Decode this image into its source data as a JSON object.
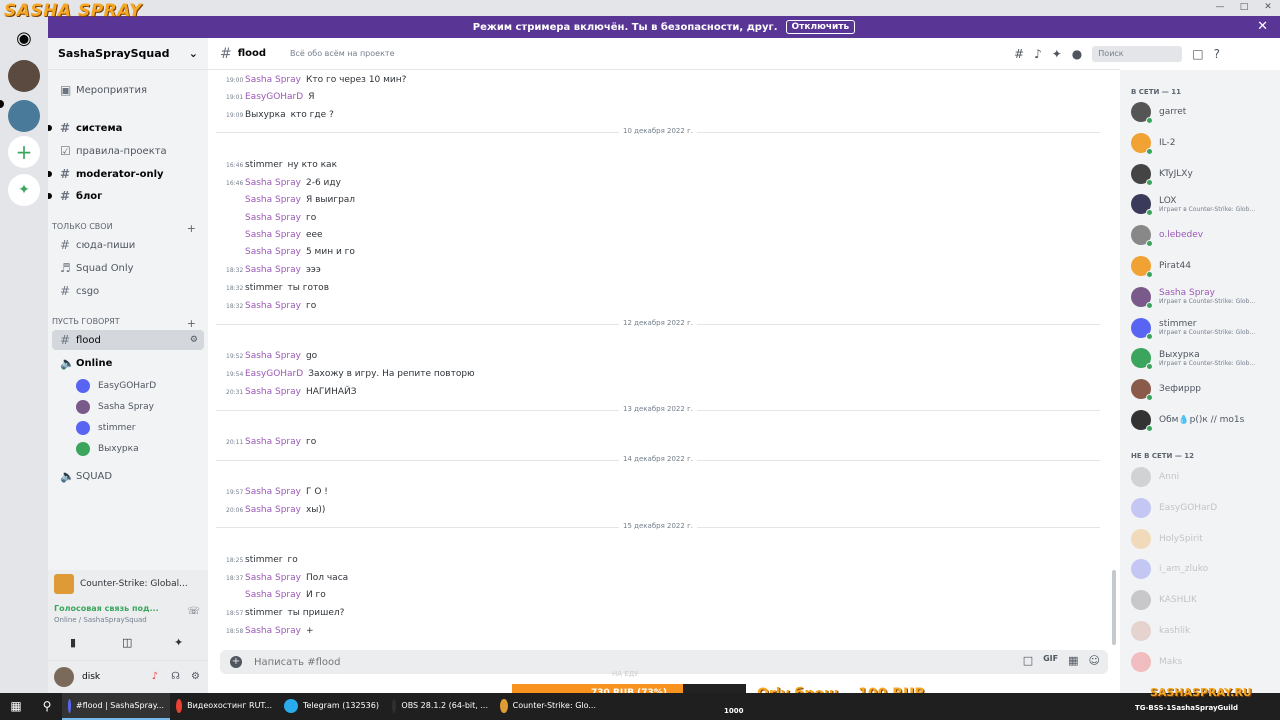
{
  "overlay": {
    "watermark": "SASHA SPRAY",
    "promo": "Orly бронь - 100 RUB",
    "brand": "SASHASPRAY.RU",
    "brand2": "TG-BSS-1SashaSprayGuild"
  },
  "banner": {
    "text": "Режим стримера включён. Ты в безопасности, друг.",
    "button": "Отключить"
  },
  "guild": {
    "name": "SashaSpraySquad"
  },
  "sidebar": {
    "events": "Мероприятия",
    "channels_top": [
      "система",
      "правила-проекта",
      "moderator-only",
      "блог"
    ],
    "cat1": "только свои",
    "channels_cat1": [
      "сюда-пиши",
      "Squad Only",
      "csgo"
    ],
    "cat2": "пусть говорят",
    "active_channel": "flood",
    "voice_channel": "Online",
    "voice_users": [
      "EasyGOHarD",
      "Sasha Spray",
      "stimmer",
      "Выхурка"
    ],
    "squad_channel": "SQUAD",
    "activity": {
      "game": "Counter-Strike: Global...",
      "voice_status": "Голосовая связь под...",
      "voice_sub": "Online / SashaSpraySquad"
    },
    "user": {
      "name": "disk"
    }
  },
  "chat": {
    "channel": "flood",
    "topic": "Всё обо всём на проекте",
    "search_placeholder": "Поиск",
    "composer_placeholder": "Написать #flood",
    "messages": [
      {
        "ts": "19:00",
        "author": "Sasha Spray",
        "color": "purple",
        "text": "Кто го через 10 мин?"
      },
      {
        "ts": "19:01",
        "author": "EasyGOHarD",
        "color": "purple",
        "text": "Я"
      },
      {
        "ts": "19:09",
        "author": "Выхурка",
        "color": "dark",
        "text": "кто где ?"
      },
      {
        "ts": "16:46",
        "author": "stimmer",
        "color": "dark",
        "text": "ну кто как"
      },
      {
        "ts": "16:46",
        "author": "Sasha Spray",
        "color": "purple",
        "text": "2-6 иду"
      },
      {
        "ts": "",
        "author": "Sasha Spray",
        "color": "purple",
        "text": "Я выиграл"
      },
      {
        "ts": "",
        "author": "Sasha Spray",
        "color": "purple",
        "text": "го"
      },
      {
        "ts": "",
        "author": "Sasha Spray",
        "color": "purple",
        "text": "еее"
      },
      {
        "ts": "",
        "author": "Sasha Spray",
        "color": "purple",
        "text": "5 мин и го"
      },
      {
        "ts": "18:32",
        "author": "Sasha Spray",
        "color": "purple",
        "text": "эээ"
      },
      {
        "ts": "18:32",
        "author": "stimmer",
        "color": "dark",
        "text": "ты готов"
      },
      {
        "ts": "18:32",
        "author": "Sasha Spray",
        "color": "purple",
        "text": "го"
      },
      {
        "ts": "19:52",
        "author": "Sasha Spray",
        "color": "purple",
        "text": "go"
      },
      {
        "ts": "19:54",
        "author": "EasyGOHarD",
        "color": "purple",
        "text": "Захожу в игру. На репите повторю"
      },
      {
        "ts": "20:31",
        "author": "Sasha Spray",
        "color": "purple",
        "text": "НАГИНАЙЗ"
      },
      {
        "ts": "20:11",
        "author": "Sasha Spray",
        "color": "purple",
        "text": "го"
      },
      {
        "ts": "19:57",
        "author": "Sasha Spray",
        "color": "purple",
        "text": "Г О !"
      },
      {
        "ts": "20:06",
        "author": "Sasha Spray",
        "color": "purple",
        "text": "хы))"
      },
      {
        "ts": "18:25",
        "author": "stimmer",
        "color": "dark",
        "text": "го"
      },
      {
        "ts": "18:37",
        "author": "Sasha Spray",
        "color": "purple",
        "text": "Пол часа"
      },
      {
        "ts": "",
        "author": "Sasha Spray",
        "color": "purple",
        "text": "И го"
      },
      {
        "ts": "18:57",
        "author": "stimmer",
        "color": "dark",
        "text": "ты пришел?"
      },
      {
        "ts": "18:58",
        "author": "Sasha Spray",
        "color": "purple",
        "text": "+"
      }
    ],
    "dates": [
      "10 декабря 2022 г.",
      "12 декабря 2022 г.",
      "13 декабря 2022 г.",
      "14 декабря 2022 г.",
      "15 декабря 2022 г."
    ]
  },
  "members": {
    "online_label": "В СЕТИ — 11",
    "offline_label": "НЕ В СЕТИ — 12",
    "online": [
      {
        "name": "garret",
        "activity": "",
        "color": "#555",
        "purple": false
      },
      {
        "name": "IL-2",
        "activity": "",
        "color": "#f0a232",
        "purple": false
      },
      {
        "name": "KTyJLXy",
        "activity": "",
        "color": "#444",
        "purple": false
      },
      {
        "name": "LOX",
        "activity": "Играет в Counter-Strike: Glob...",
        "color": "#3a3a5a",
        "purple": false
      },
      {
        "name": "o.lebedev",
        "activity": "",
        "color": "#888",
        "purple": true
      },
      {
        "name": "Pirat44",
        "activity": "",
        "color": "#f0a232",
        "purple": false
      },
      {
        "name": "Sasha Spray",
        "activity": "Играет в Counter-Strike: Glob...",
        "color": "#7a5a8a",
        "purple": true
      },
      {
        "name": "stimmer",
        "activity": "Играет в Counter-Strike: Glob...",
        "color": "#5865f2",
        "purple": false
      },
      {
        "name": "Выхурка",
        "activity": "Играет в Counter-Strike: Glob...",
        "color": "#3ba55d",
        "purple": false
      },
      {
        "name": "Зефиррр",
        "activity": "",
        "color": "#8a5a4a",
        "purple": false
      },
      {
        "name": "Обм💧р()к // mo1s",
        "activity": "",
        "color": "#333",
        "purple": false
      }
    ],
    "offline": [
      {
        "name": "Anni",
        "color": "#888"
      },
      {
        "name": "EasyGOHarD",
        "color": "#5865f2"
      },
      {
        "name": "HolySpirit",
        "color": "#f0a232"
      },
      {
        "name": "i_am_zluko",
        "color": "#5865f2"
      },
      {
        "name": "KASHLIK",
        "color": "#666"
      },
      {
        "name": "kashlik",
        "color": "#c98a7a"
      },
      {
        "name": "Maks",
        "color": "#ed4245"
      }
    ]
  },
  "donation": {
    "title": "НА ЕДУ",
    "label": "730 RUB (73%)",
    "progress": 0.73,
    "max": "1000"
  },
  "taskbar": {
    "items": [
      {
        "label": "#flood | SashaSpray...",
        "color": "#5865f2"
      },
      {
        "label": "Видеохостинг RUT...",
        "color": "#e94235"
      },
      {
        "label": "Telegram (132536)",
        "color": "#2aabee"
      },
      {
        "label": "OBS 28.1.2 (64-bit, ...",
        "color": "#302e31"
      },
      {
        "label": "Counter-Strike: Glo...",
        "color": "#de9b35"
      }
    ]
  }
}
